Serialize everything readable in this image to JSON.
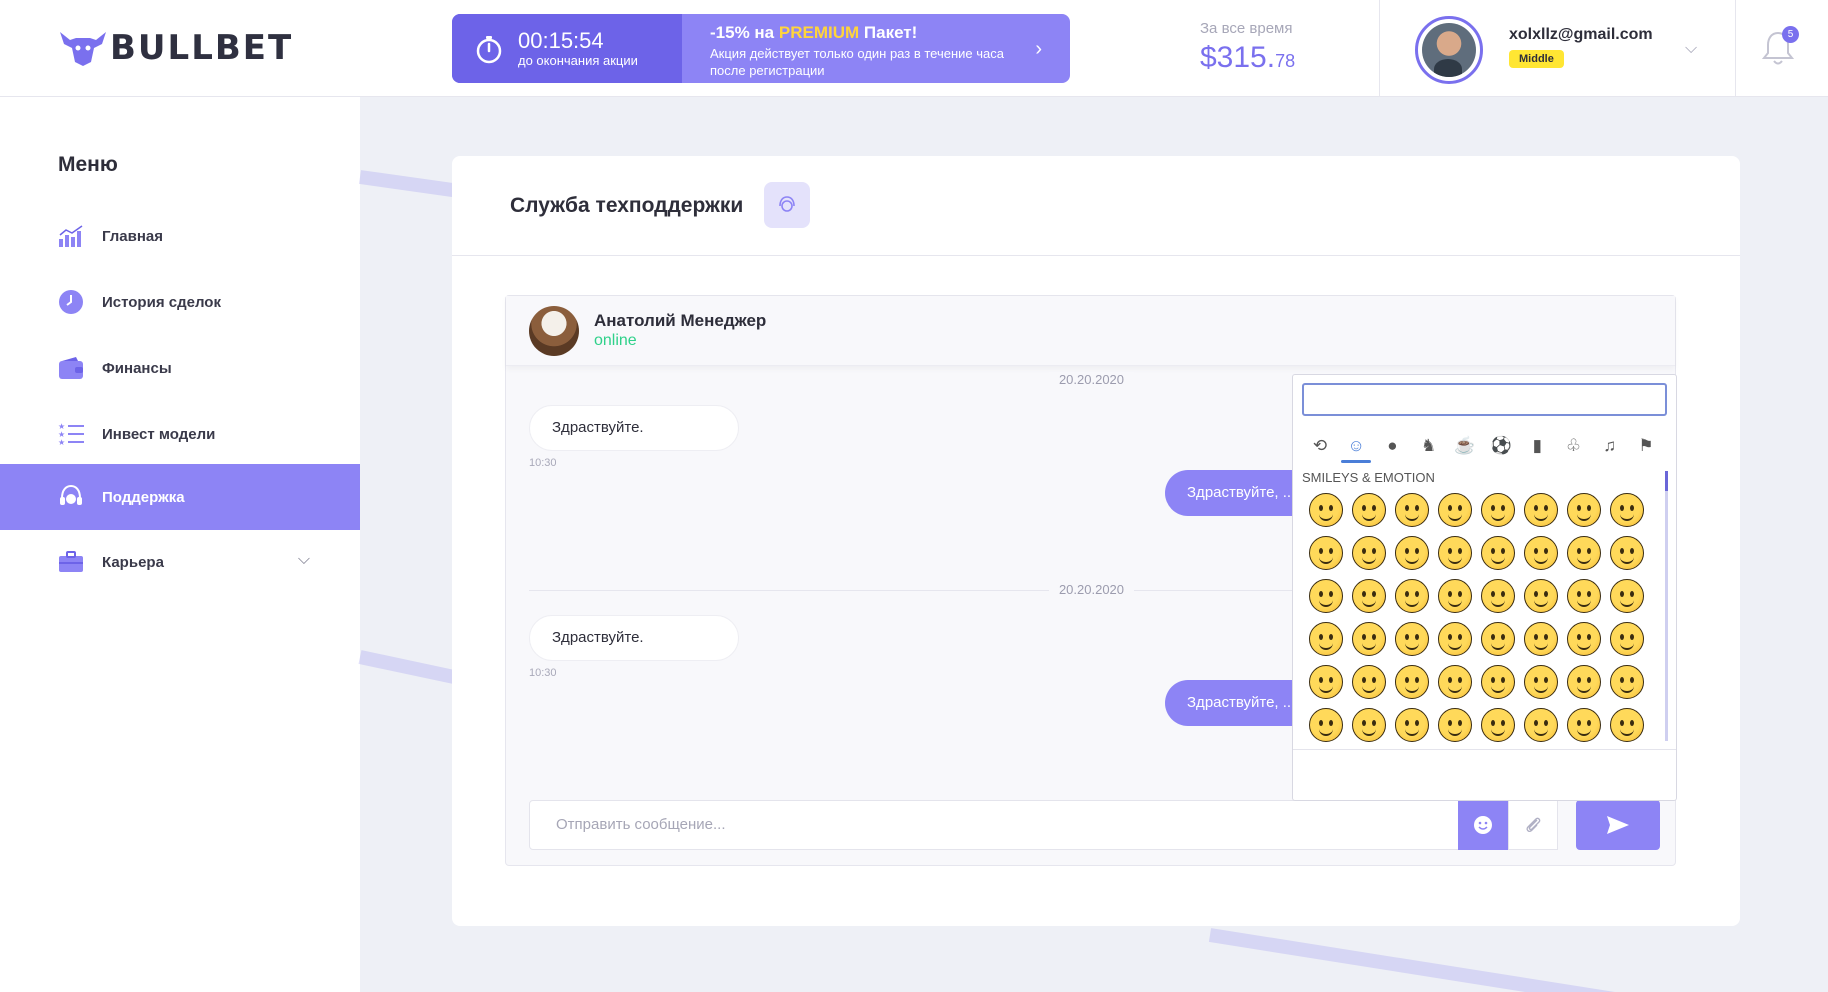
{
  "brand": {
    "name": "BULLBET"
  },
  "promo": {
    "timer": "00:15:54",
    "timer_sub": "до окончания акции",
    "discount": "-15% на",
    "premium": "PREMIUM",
    "package": "Пакет!",
    "description": "Акция действует только один раз в течение часа после регистрации"
  },
  "balance": {
    "label": "За все время",
    "amount": "$315.",
    "cents": "78"
  },
  "profile": {
    "email": "xolxllz@gmail.com",
    "level": "Middle"
  },
  "notifications": {
    "count": "5"
  },
  "sidebar": {
    "title": "Меню",
    "items": [
      {
        "label": "Главная",
        "icon": "chart-bars-icon"
      },
      {
        "label": "История сделок",
        "icon": "clock-icon"
      },
      {
        "label": "Финансы",
        "icon": "wallet-icon"
      },
      {
        "label": "Инвест модели",
        "icon": "list-stars-icon"
      },
      {
        "label": "Поддержка",
        "icon": "headset-icon",
        "active": true
      },
      {
        "label": "Карьера",
        "icon": "briefcase-icon"
      }
    ]
  },
  "support": {
    "title": "Служба техподдержки",
    "manager": {
      "name": "Анатолий Менеджер",
      "status": "online"
    },
    "messages": [
      {
        "date": "20.20.2020",
        "incoming": "Здраствуйте.",
        "time": "10:30",
        "outgoing": "Здраствуйте, ..."
      },
      {
        "date": "20.20.2020",
        "incoming": "Здраствуйте.",
        "time": "10:30",
        "outgoing": "Здраствуйте, ..."
      }
    ],
    "input_placeholder": "Отправить сообщение..."
  },
  "emoji_picker": {
    "search_value": "",
    "section": "SMILEYS & EMOTION",
    "categories": [
      "recent",
      "smileys",
      "people",
      "animals",
      "food",
      "activities",
      "places",
      "objects",
      "symbols",
      "flags"
    ],
    "active_category": "smileys"
  },
  "colors": {
    "accent": "#8d84f5",
    "accent_dark": "#6d63e8",
    "online": "#2fd18a",
    "badge": "#ffe633"
  }
}
